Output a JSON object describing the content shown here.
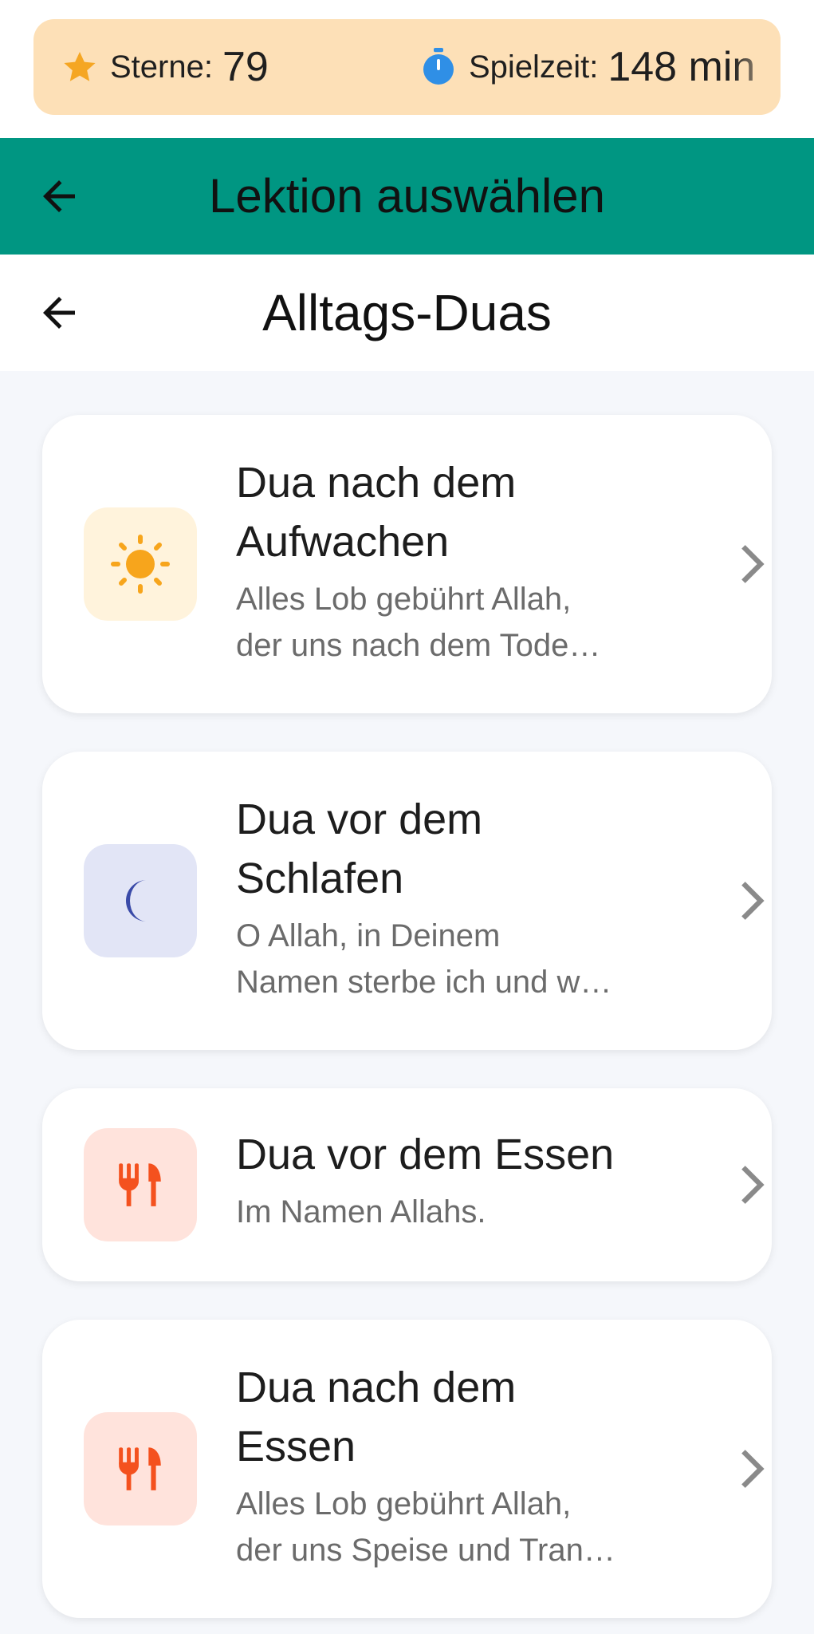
{
  "stats": {
    "stars_label": "Sterne:",
    "stars_value": "79",
    "time_label": "Spielzeit:",
    "time_value": "148 min"
  },
  "appbar": {
    "title": "Lektion auswählen"
  },
  "subheader": {
    "title": "Alltags-Duas"
  },
  "lessons": [
    {
      "title_line1": "Dua nach dem",
      "title_line2": "Aufwachen",
      "sub_line1": "Alles Lob gebührt Allah,",
      "sub_line2": "der uns nach dem Tode…",
      "icon": "sun-icon"
    },
    {
      "title_line1": "Dua vor dem",
      "title_line2": "Schlafen",
      "sub_line1": "O Allah, in Deinem",
      "sub_line2": "Namen sterbe ich und w…",
      "icon": "moon-icon"
    },
    {
      "title_line1": "Dua vor dem Essen",
      "sub_line1": "Im Namen Allahs.",
      "icon": "fork-knife-icon"
    },
    {
      "title_line1": "Dua nach dem",
      "title_line2": "Essen",
      "sub_line1": "Alles Lob gebührt Allah,",
      "sub_line2": "der uns Speise und Tran…",
      "icon": "fork-knife-icon"
    }
  ],
  "colors": {
    "stats_bg": "#fde0b7",
    "appbar_bg": "#009682",
    "list_bg": "#f5f7fb",
    "star": "#f5a623",
    "timer": "#2f8fe6",
    "sun_bg": "#fff3dc",
    "sun": "#f7a51c",
    "moon_bg": "#e2e5f6",
    "moon": "#3a4aa8",
    "food_bg": "#ffe3dc",
    "food": "#f4511e"
  }
}
